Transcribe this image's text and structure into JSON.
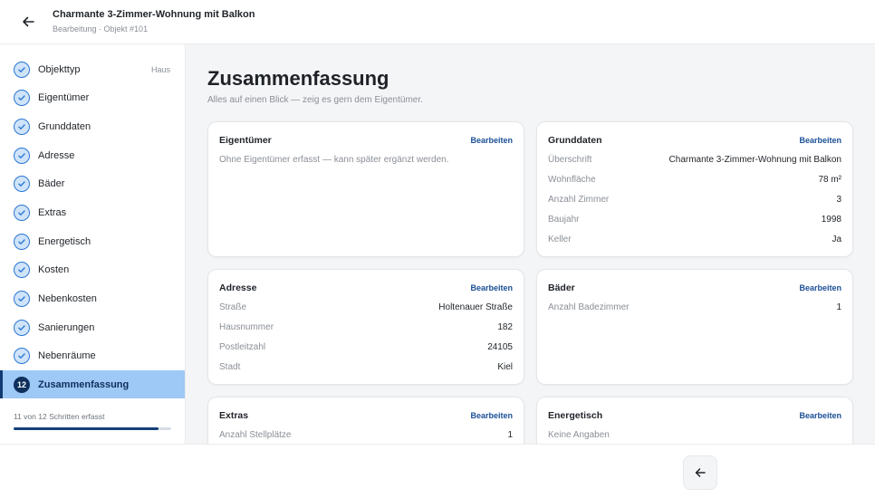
{
  "header": {
    "title": "Charmante 3-Zimmer-Wohnung mit Balkon",
    "subtitle": "Bearbeitung · Objekt #101"
  },
  "sidebar": {
    "steps": [
      {
        "label": "Objekttyp",
        "tag": "Haus"
      },
      {
        "label": "Eigentümer"
      },
      {
        "label": "Grunddaten"
      },
      {
        "label": "Adresse"
      },
      {
        "label": "Bäder"
      },
      {
        "label": "Extras"
      },
      {
        "label": "Energetisch"
      },
      {
        "label": "Kosten"
      },
      {
        "label": "Nebenkosten"
      },
      {
        "label": "Sanierungen"
      },
      {
        "label": "Nebenräume"
      }
    ],
    "active": {
      "number": "12",
      "label": "Zusammenfassung"
    },
    "progress_text": "11 von 12 Schritten erfasst",
    "progress_fraction": 0.917
  },
  "main": {
    "title": "Zusammenfassung",
    "subtitle": "Alles auf einen Blick — zeig es gern dem Eigentümer."
  },
  "edit_label": "Bearbeiten",
  "cards": {
    "eigentuemer": {
      "title": "Eigentümer",
      "note": "Ohne Eigentümer erfasst — kann später ergänzt werden."
    },
    "grunddaten": {
      "title": "Grunddaten",
      "rows": [
        {
          "k": "Überschrift",
          "v": "Charmante 3-Zimmer-Wohnung mit Balkon"
        },
        {
          "k": "Wohnfläche",
          "v": "78 m²"
        },
        {
          "k": "Anzahl Zimmer",
          "v": "3"
        },
        {
          "k": "Baujahr",
          "v": "1998"
        },
        {
          "k": "Keller",
          "v": "Ja"
        }
      ]
    },
    "adresse": {
      "title": "Adresse",
      "rows": [
        {
          "k": "Straße",
          "v": "Holtenauer Straße"
        },
        {
          "k": "Hausnummer",
          "v": "182"
        },
        {
          "k": "Postleitzahl",
          "v": "24105"
        },
        {
          "k": "Stadt",
          "v": "Kiel"
        }
      ]
    },
    "baeder": {
      "title": "Bäder",
      "rows": [
        {
          "k": "Anzahl Badezimmer",
          "v": "1"
        }
      ]
    },
    "extras": {
      "title": "Extras",
      "rows": [
        {
          "k": "Anzahl Stellplätze",
          "v": "1"
        }
      ]
    },
    "energetisch": {
      "title": "Energetisch",
      "note": "Keine Angaben"
    }
  },
  "colors": {
    "accent": "#1a4f96",
    "active_step_bg": "#9ec8f5",
    "check_fill": "#cfe3fa"
  },
  "icons": {
    "back": "arrow-left-icon",
    "step_done": "check-circle-icon",
    "previous": "arrow-left-icon"
  }
}
